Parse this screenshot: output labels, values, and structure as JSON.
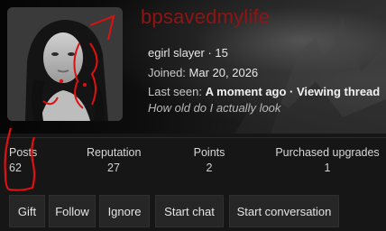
{
  "profile": {
    "username": "bpsavedmylife",
    "title_prefix": "egirl slayer",
    "title_separator": " · ",
    "title_suffix": "15",
    "joined_label": "Joined:",
    "joined_value": "Mar 20, 2026",
    "last_seen_label": "Last seen:",
    "last_seen_value": "A moment ago",
    "last_seen_separator": " · ",
    "last_seen_activity": "Viewing thread",
    "status_message": "How old do I actually look"
  },
  "stats": [
    {
      "label": "Posts",
      "value": "62"
    },
    {
      "label": "Reputation",
      "value": "27"
    },
    {
      "label": "Points",
      "value": "2"
    },
    {
      "label": "Purchased upgrades",
      "value": "1"
    }
  ],
  "actions": {
    "gift": "Gift",
    "follow": "Follow",
    "ignore": "Ignore",
    "start_chat": "Start chat",
    "start_conversation": "Start conversation"
  },
  "colors": {
    "username": "#8f1515",
    "annotation_scribble": "#e01010",
    "background": "#161616",
    "button_bg": "#262626"
  }
}
